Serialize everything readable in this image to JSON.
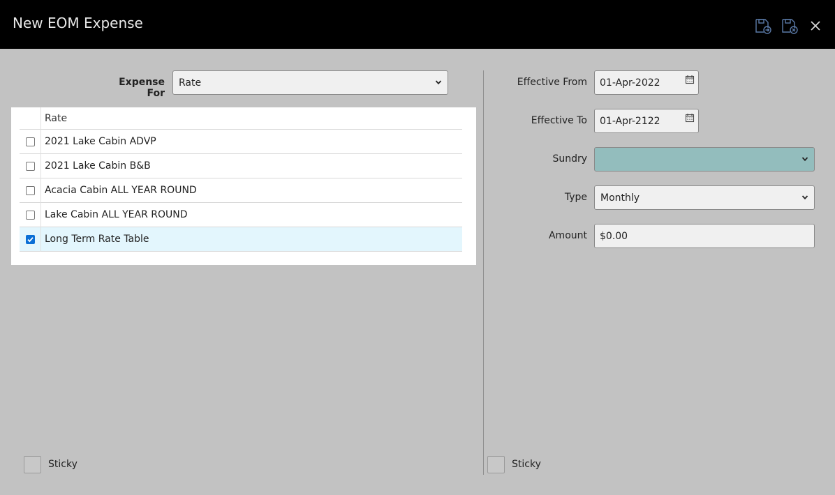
{
  "window": {
    "title": "New EOM Expense"
  },
  "toolbar": {
    "save_icon": "save-and-new-icon",
    "save_close_icon": "save-and-close-icon",
    "close_icon": "close-icon"
  },
  "left": {
    "expense_for_label": "Expense For",
    "expense_for_value": "Rate",
    "table": {
      "column_header": "Rate",
      "rows": [
        {
          "label": "2021 Lake Cabin ADVP",
          "checked": false
        },
        {
          "label": "2021 Lake Cabin B&B",
          "checked": false
        },
        {
          "label": "Acacia Cabin ALL YEAR ROUND",
          "checked": false
        },
        {
          "label": "Lake Cabin ALL YEAR ROUND",
          "checked": false
        },
        {
          "label": "Long Term Rate Table",
          "checked": true
        }
      ]
    },
    "sticky_label": "Sticky"
  },
  "right": {
    "effective_from_label": "Effective From",
    "effective_from_value": "01-Apr-2022",
    "effective_to_label": "Effective To",
    "effective_to_value": "01-Apr-2122",
    "sundry_label": "Sundry",
    "sundry_value": "",
    "type_label": "Type",
    "type_value": "Monthly",
    "amount_label": "Amount",
    "amount_value": "$0.00",
    "sticky_label": "Sticky"
  },
  "colors": {
    "titlebar": "#000000",
    "background": "#c2c2c2",
    "sundry_fill": "#93bdbd",
    "selected_row": "#e3f6fd",
    "checkbox_checked": "#0a6fd6",
    "toolbar_icon": "#5b7aa8"
  }
}
